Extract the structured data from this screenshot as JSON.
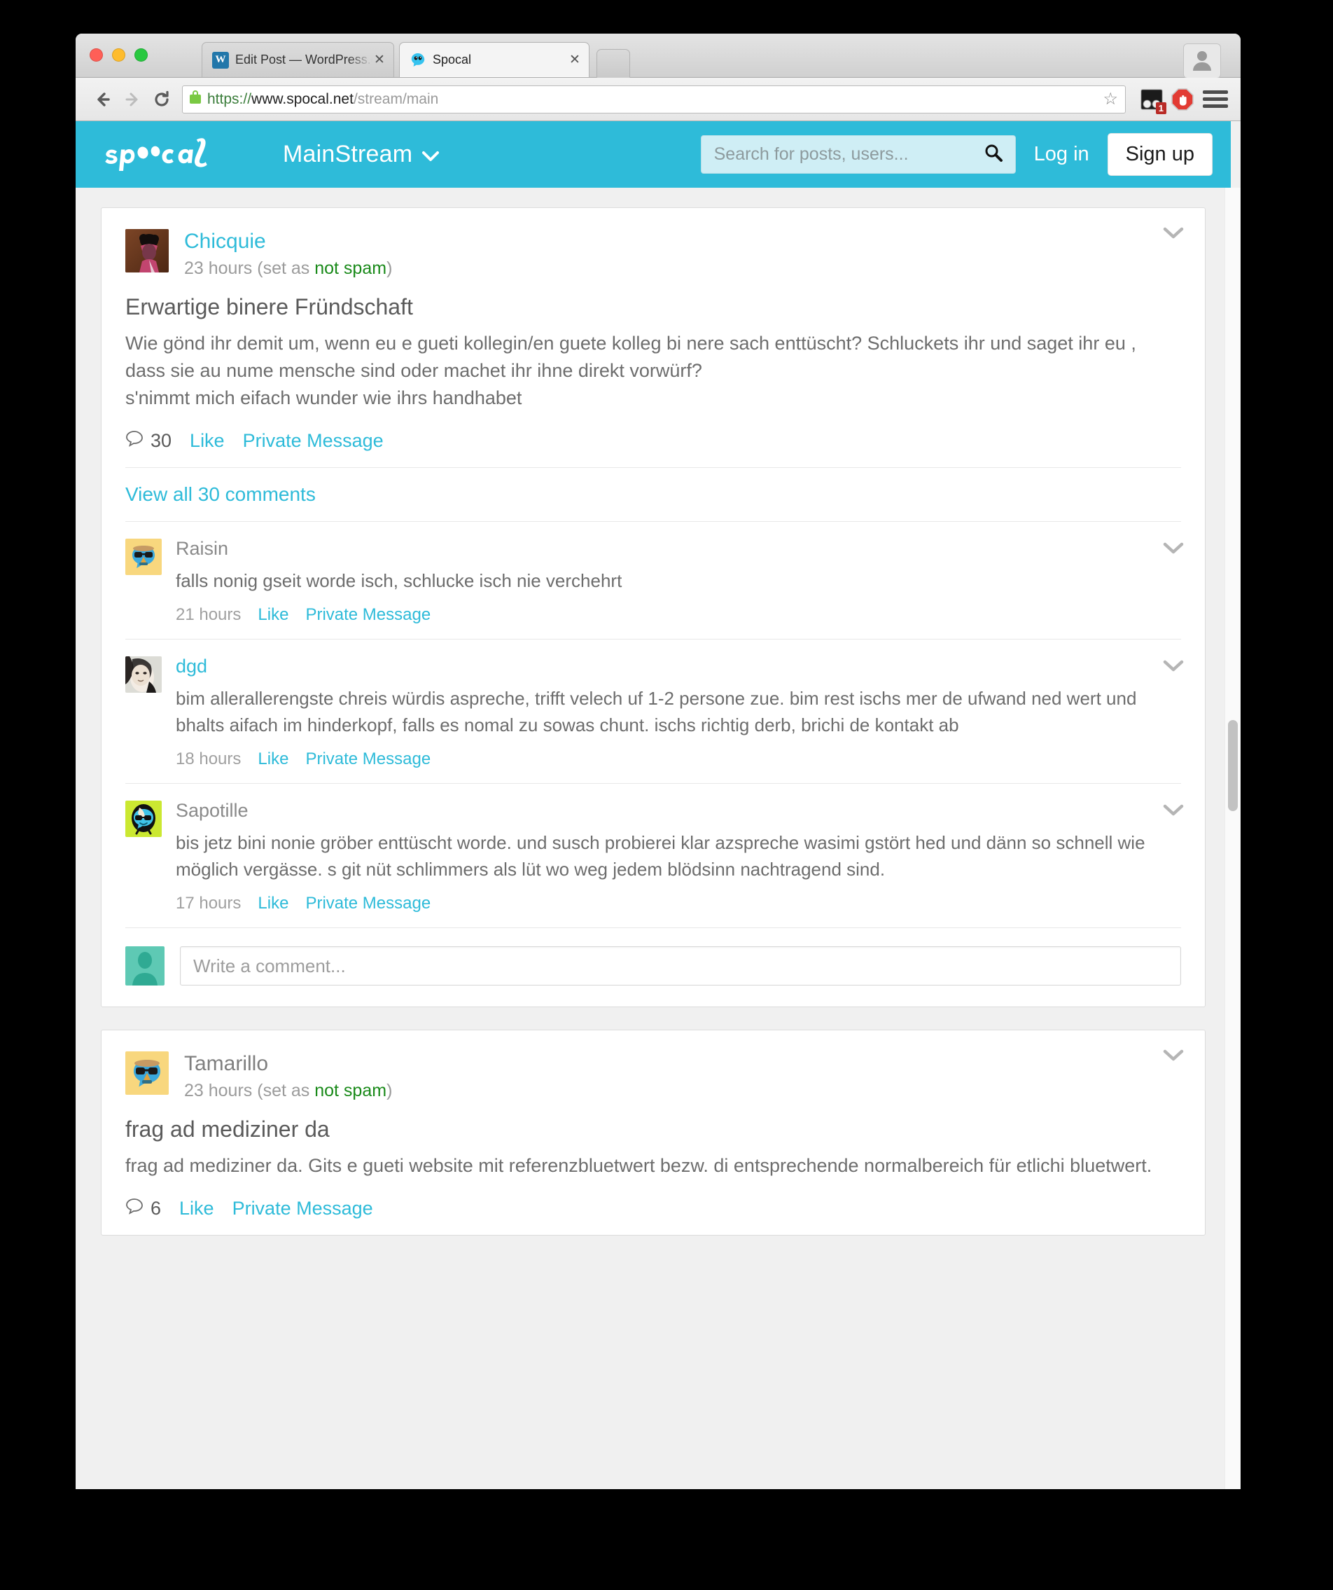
{
  "browser": {
    "tabs": [
      {
        "title": "Edit Post — WordPress.com",
        "favicon": "wordpress-icon",
        "active": false,
        "close_label": "✕"
      },
      {
        "title": "Spocal",
        "favicon": "spocal-icon",
        "active": true,
        "close_label": "✕"
      }
    ],
    "url": {
      "scheme": "https://",
      "host": "www.spocal.net",
      "path": "/stream/main",
      "security": "secure-lock-icon"
    },
    "extensions": [
      {
        "name": "pocket-extension-icon",
        "badge": "1"
      },
      {
        "name": "adblock-icon",
        "badge": ""
      }
    ],
    "menu_icon": "hamburger-menu-icon",
    "profile_icon": "person-icon",
    "back_icon": "back-arrow-icon",
    "forward_icon": "forward-arrow-icon",
    "reload_icon": "reload-icon",
    "bookmark_icon": "star-icon"
  },
  "app": {
    "brand": "spocal",
    "stream_name": "MainStream",
    "stream_caret": "chevron-down-icon",
    "search": {
      "value": "",
      "placeholder": "Search for posts, users..."
    },
    "login_label": "Log in",
    "signup_label": "Sign up",
    "accent_color": "#2ebbd9",
    "header_bg": "#2ebbd9"
  },
  "posts": [
    {
      "author": "Chicquie",
      "time": "23 hours",
      "spam_prefix": "(set as ",
      "spam_label": "not spam",
      "spam_suffix": ")",
      "title": "Erwartige binere Fründschaft",
      "body": "Wie gönd ihr demit um, wenn eu e gueti kollegin/en guete kolleg bi nere sach enttüscht? Schluckets ihr und saget ihr eu , dass sie au nume mensche sind oder machet ihr ihne direkt vorwürf?\ns'nimmt mich eifach wunder wie ihrs handhabet",
      "comment_count": "30",
      "like_label": "Like",
      "pm_label": "Private Message",
      "view_all_label": "View all 30 comments",
      "caret": "chevron-down-icon",
      "comments": [
        {
          "author": "Raisin",
          "author_is_link": false,
          "text": "falls nonig gseit worde isch, schlucke isch nie verchehrt",
          "time": "21 hours",
          "like_label": "Like",
          "pm_label": "Private Message",
          "caret": "chevron-down-icon",
          "avatar": "bubble-hat-sunglasses-yellow"
        },
        {
          "author": "dgd",
          "author_is_link": true,
          "text": "bim allerallerengste chreis würdis aspreche, trifft velech uf 1-2 persone zue. bim rest ischs mer de ufwand ned wert und bhalts aifach im hinderkopf, falls es nomal zu sowas chunt. ischs richtig derb, brichi de kontakt ab",
          "time": "18 hours",
          "like_label": "Like",
          "pm_label": "Private Message",
          "caret": "chevron-down-icon",
          "avatar": "photo-portrait-bw"
        },
        {
          "author": "Sapotille",
          "author_is_link": false,
          "text": "bis jetz bini nonie gröber enttüscht worde. und susch probierei klar azspreche wasimi gstört hed und dänn so schnell wie möglich vergässe. s git nüt schlimmers als lüt wo weg jedem blödsinn nachtragend sind.",
          "time": "17 hours",
          "like_label": "Like",
          "pm_label": "Private Message",
          "caret": "chevron-down-icon",
          "avatar": "bubble-sunglasses-green"
        }
      ],
      "write_comment": {
        "value": "",
        "placeholder": "Write a comment...",
        "avatar": "default-person-teal"
      }
    },
    {
      "author": "Tamarillo",
      "time": "23 hours",
      "spam_prefix": "(set as ",
      "spam_label": "not spam",
      "spam_suffix": ")",
      "title": "frag ad mediziner da",
      "body": "frag ad mediziner da. Gits e gueti website mit referenzbluetwert bezw. di entsprechende normalbereich für etlichi bluetwert.",
      "comment_count": "6",
      "like_label": "Like",
      "pm_label": "Private Message",
      "caret": "chevron-down-icon"
    }
  ]
}
